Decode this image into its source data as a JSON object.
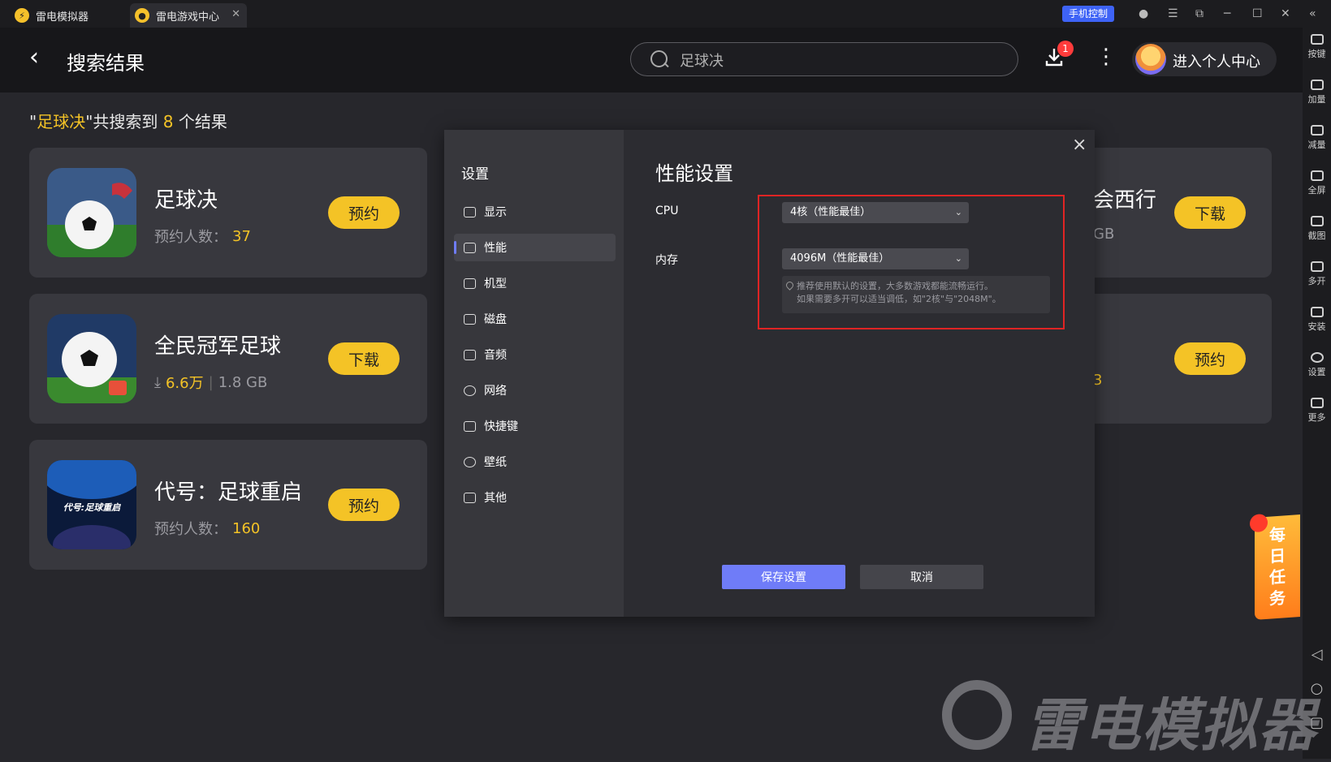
{
  "titlebar": {
    "tabs": [
      {
        "label": "雷电模拟器"
      },
      {
        "label": "雷电游戏中心"
      }
    ],
    "phone_control": "手机控制"
  },
  "header": {
    "title": "搜索结果",
    "search_value": "足球决",
    "download_badge": "1",
    "profile_label": "进入个人中心"
  },
  "summary": {
    "quote_open": "\"",
    "query": "足球决",
    "mid": "\"共搜索到 ",
    "count": "8",
    "tail": " 个结果"
  },
  "results": [
    {
      "name": "足球决",
      "meta_label": "预约人数：",
      "meta_value": "37",
      "button": "预约"
    },
    {
      "name": "全民冠军足球",
      "meta_value": "6.6万",
      "meta_size": "1.8 GB",
      "button": "下载"
    },
    {
      "name": "代号：足球重启",
      "meta_label": "预约人数：",
      "meta_value": "160",
      "button": "预约"
    }
  ],
  "right_results": [
    {
      "name_fragment": "会西行",
      "sub_fragment": "GB",
      "button": "下载"
    },
    {
      "name_fragment": "",
      "sub_fragment": "3",
      "button": "预约"
    }
  ],
  "sidebar": {
    "items": [
      "按键",
      "加量",
      "减量",
      "全屏",
      "截图",
      "多开",
      "安装",
      "设置",
      "更多"
    ]
  },
  "daily_task": "每日任务",
  "watermark": "雷电模拟器",
  "dialog": {
    "nav_title": "设置",
    "nav_items": [
      "显示",
      "性能",
      "机型",
      "磁盘",
      "音频",
      "网络",
      "快捷键",
      "壁纸",
      "其他"
    ],
    "active_index": 1,
    "heading": "性能设置",
    "cpu_label": "CPU",
    "cpu_value": "4核（性能最佳）",
    "memory_label": "内存",
    "memory_value": "4096M（性能最佳）",
    "hint_line1": "推荐使用默认的设置，大多数游戏都能流畅运行。",
    "hint_line2": "如果需要多开可以适当调低，如\"2核\"与\"2048M\"。",
    "save_label": "保存设置",
    "cancel_label": "取消"
  }
}
